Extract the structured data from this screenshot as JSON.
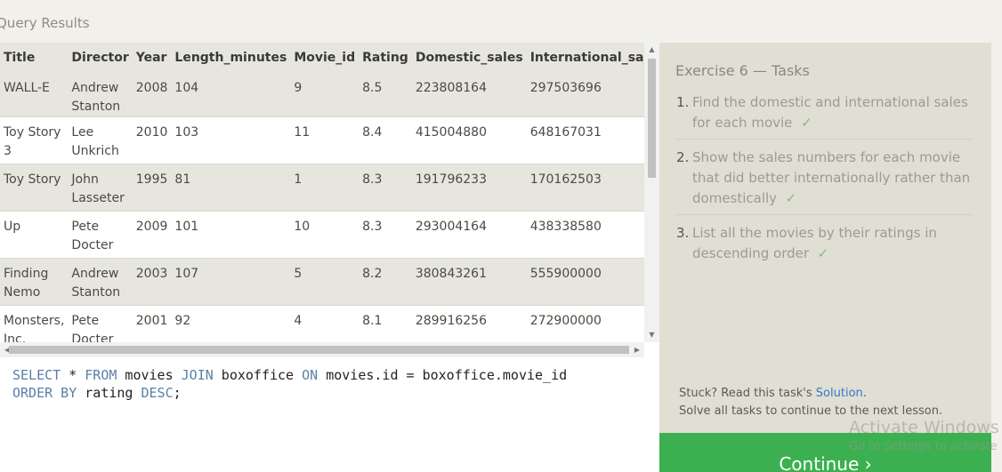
{
  "section_title": "Query Results",
  "table": {
    "columns": [
      "Title",
      "Director",
      "Year",
      "Length_minutes",
      "Movie_id",
      "Rating",
      "Domestic_sales",
      "International_sales"
    ],
    "rows": [
      [
        "WALL-E",
        "Andrew Stanton",
        "2008",
        "104",
        "9",
        "8.5",
        "223808164",
        "297503696"
      ],
      [
        "Toy Story 3",
        "Lee Unkrich",
        "2010",
        "103",
        "11",
        "8.4",
        "415004880",
        "648167031"
      ],
      [
        "Toy Story",
        "John Lasseter",
        "1995",
        "81",
        "1",
        "8.3",
        "191796233",
        "170162503"
      ],
      [
        "Up",
        "Pete Docter",
        "2009",
        "101",
        "10",
        "8.3",
        "293004164",
        "438338580"
      ],
      [
        "Finding Nemo",
        "Andrew Stanton",
        "2003",
        "107",
        "5",
        "8.2",
        "380843261",
        "555900000"
      ],
      [
        "Monsters, Inc.",
        "Pete Docter",
        "2001",
        "92",
        "4",
        "8.1",
        "289916256",
        "272900000"
      ]
    ]
  },
  "editor": {
    "line1": {
      "k1": "SELECT",
      "t1": " * ",
      "k2": "FROM",
      "t2": " movies ",
      "k3": "JOIN",
      "t3": " boxoffice ",
      "k4": "ON",
      "t4": " movies.id = boxoffice.movie_id"
    },
    "line2": {
      "k1": "ORDER BY",
      "t1": " rating ",
      "k2": "DESC",
      "t2": ";"
    }
  },
  "panel": {
    "title": "Exercise 6 — Tasks",
    "tasks": [
      {
        "num": "1.",
        "text": "Find the domestic and international sales for each movie",
        "check": "✓"
      },
      {
        "num": "2.",
        "text": "Show the sales numbers for each movie that did better internationally rather than domestically",
        "check": "✓"
      },
      {
        "num": "3.",
        "text": "List all the movies by their ratings in descending order",
        "check": "✓"
      }
    ],
    "stuck_prefix": "Stuck? Read this task's ",
    "solution_link": "Solution",
    "stuck_suffix": ".",
    "hint": "Solve all tasks to continue to the next lesson.",
    "continue_label": "Continue ›"
  },
  "watermark": {
    "line1": "Activate Windows",
    "line2": "Go to Settings to activate"
  }
}
